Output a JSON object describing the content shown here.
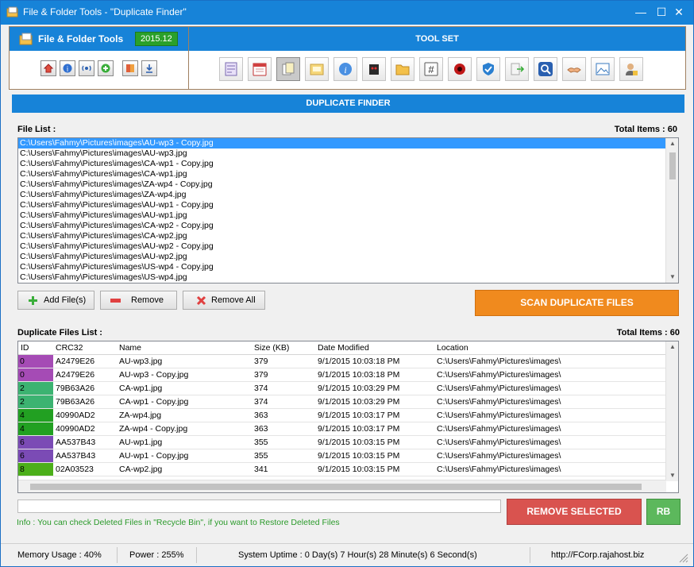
{
  "window": {
    "title": "File & Folder Tools - \"Duplicate Finder\"",
    "minimize": "—",
    "maximize": "☐",
    "close": "✕"
  },
  "header": {
    "app_title": "File & Folder Tools",
    "version": "2015.12",
    "toolset_title": "TOOL SET"
  },
  "section_title": "DUPLICATE FINDER",
  "file_list": {
    "label": "File List :",
    "total_label": "Total Items : 60",
    "items": [
      "C:\\Users\\Fahmy\\Pictures\\images\\AU-wp3 - Copy.jpg",
      "C:\\Users\\Fahmy\\Pictures\\images\\AU-wp3.jpg",
      "C:\\Users\\Fahmy\\Pictures\\images\\CA-wp1 - Copy.jpg",
      "C:\\Users\\Fahmy\\Pictures\\images\\CA-wp1.jpg",
      "C:\\Users\\Fahmy\\Pictures\\images\\ZA-wp4 - Copy.jpg",
      "C:\\Users\\Fahmy\\Pictures\\images\\ZA-wp4.jpg",
      "C:\\Users\\Fahmy\\Pictures\\images\\AU-wp1 - Copy.jpg",
      "C:\\Users\\Fahmy\\Pictures\\images\\AU-wp1.jpg",
      "C:\\Users\\Fahmy\\Pictures\\images\\CA-wp2 - Copy.jpg",
      "C:\\Users\\Fahmy\\Pictures\\images\\CA-wp2.jpg",
      "C:\\Users\\Fahmy\\Pictures\\images\\AU-wp2 - Copy.jpg",
      "C:\\Users\\Fahmy\\Pictures\\images\\AU-wp2.jpg",
      "C:\\Users\\Fahmy\\Pictures\\images\\US-wp4 - Copy.jpg",
      "C:\\Users\\Fahmy\\Pictures\\images\\US-wp4.jpg"
    ],
    "buttons": {
      "add": "Add File(s)",
      "remove": "Remove",
      "remove_all": "Remove All"
    }
  },
  "scan_button": "SCAN DUPLICATE FILES",
  "duplicates": {
    "label": "Duplicate Files List :",
    "total_label": "Total Items : 60",
    "columns": [
      "ID",
      "CRC32",
      "Name",
      "Size (KB)",
      "Date Modified",
      "Location"
    ],
    "rows": [
      {
        "id": "0",
        "crc": "A2479E26",
        "name": "AU-wp3.jpg",
        "size": "379",
        "date": "9/1/2015 10:03:18 PM",
        "loc": "C:\\Users\\Fahmy\\Pictures\\images\\"
      },
      {
        "id": "0",
        "crc": "A2479E26",
        "name": "AU-wp3 - Copy.jpg",
        "size": "379",
        "date": "9/1/2015 10:03:18 PM",
        "loc": "C:\\Users\\Fahmy\\Pictures\\images\\"
      },
      {
        "id": "2",
        "crc": "79B63A26",
        "name": "CA-wp1.jpg",
        "size": "374",
        "date": "9/1/2015 10:03:29 PM",
        "loc": "C:\\Users\\Fahmy\\Pictures\\images\\"
      },
      {
        "id": "2",
        "crc": "79B63A26",
        "name": "CA-wp1 - Copy.jpg",
        "size": "374",
        "date": "9/1/2015 10:03:29 PM",
        "loc": "C:\\Users\\Fahmy\\Pictures\\images\\"
      },
      {
        "id": "4",
        "crc": "40990AD2",
        "name": "ZA-wp4.jpg",
        "size": "363",
        "date": "9/1/2015 10:03:17 PM",
        "loc": "C:\\Users\\Fahmy\\Pictures\\images\\"
      },
      {
        "id": "4",
        "crc": "40990AD2",
        "name": "ZA-wp4 - Copy.jpg",
        "size": "363",
        "date": "9/1/2015 10:03:17 PM",
        "loc": "C:\\Users\\Fahmy\\Pictures\\images\\"
      },
      {
        "id": "6",
        "crc": "AA537B43",
        "name": "AU-wp1.jpg",
        "size": "355",
        "date": "9/1/2015 10:03:15 PM",
        "loc": "C:\\Users\\Fahmy\\Pictures\\images\\"
      },
      {
        "id": "6",
        "crc": "AA537B43",
        "name": "AU-wp1 - Copy.jpg",
        "size": "355",
        "date": "9/1/2015 10:03:15 PM",
        "loc": "C:\\Users\\Fahmy\\Pictures\\images\\"
      },
      {
        "id": "8",
        "crc": "02A03523",
        "name": "CA-wp2.jpg",
        "size": "341",
        "date": "9/1/2015 10:03:15 PM",
        "loc": "C:\\Users\\Fahmy\\Pictures\\images\\"
      }
    ],
    "id_colors": {
      "0": "#a54bb5",
      "2": "#3cb371",
      "4": "#22a022",
      "6": "#7b4bb5",
      "8": "#4caf1a"
    }
  },
  "remove_selected": "REMOVE SELECTED",
  "rb_button": "RB",
  "info_text": "Info : You can check Deleted Files in \"Recycle Bin\", if you want to Restore Deleted Files",
  "status": {
    "memory": "Memory Usage : 40%",
    "power": "Power : 255%",
    "uptime": "System Uptime : 0 Day(s) 7 Hour(s) 28 Minute(s) 6 Second(s)",
    "url": "http://FCorp.rajahost.biz"
  },
  "small_icons": [
    "home-icon",
    "info-icon",
    "broadcast-icon",
    "add-icon",
    "book-icon",
    "download-icon"
  ],
  "tool_icons": [
    "form-icon",
    "calendar-icon",
    "files-icon",
    "folder-note-icon",
    "info-icon",
    "robot-icon",
    "folder-icon",
    "hash-icon",
    "virus-icon",
    "shield-icon",
    "export-icon",
    "search-icon",
    "handshake-icon",
    "image-icon",
    "user-lock-icon"
  ]
}
